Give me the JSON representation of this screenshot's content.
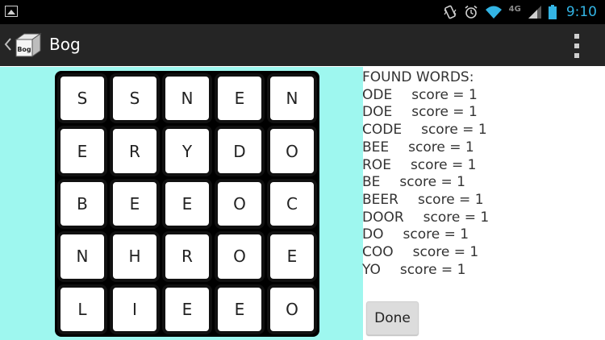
{
  "status_bar": {
    "time": "9:10",
    "network": "4G",
    "icons": [
      "gallery-icon",
      "vibrate-icon",
      "alarm-icon",
      "wifi-icon",
      "signal-icon",
      "battery-icon"
    ]
  },
  "action_bar": {
    "title": "Bog",
    "app_icon_label": "Bog",
    "icons": [
      "up-caret-icon",
      "app-icon",
      "overflow-menu-icon"
    ]
  },
  "board": {
    "rows": [
      [
        "S",
        "S",
        "N",
        "E",
        "N"
      ],
      [
        "E",
        "R",
        "Y",
        "D",
        "O"
      ],
      [
        "B",
        "E",
        "E",
        "O",
        "C"
      ],
      [
        "N",
        "H",
        "R",
        "O",
        "E"
      ],
      [
        "L",
        "I",
        "E",
        "E",
        "O"
      ]
    ]
  },
  "found": {
    "heading": "FOUND WORDS:",
    "items": [
      {
        "word": "ODE",
        "score": "score = 1"
      },
      {
        "word": "DOE",
        "score": "score = 1"
      },
      {
        "word": "CODE",
        "score": "score = 1"
      },
      {
        "word": "BEE",
        "score": "score = 1"
      },
      {
        "word": "ROE",
        "score": "score = 1"
      },
      {
        "word": "BE",
        "score": "score = 1"
      },
      {
        "word": "BEER",
        "score": "score = 1"
      },
      {
        "word": "DOOR",
        "score": "score = 1"
      },
      {
        "word": "DO",
        "score": "score = 1"
      },
      {
        "word": "COO",
        "score": "score = 1"
      },
      {
        "word": "YO",
        "score": "score = 1"
      }
    ]
  },
  "done_label": "Done",
  "colors": {
    "board_background": "#9ef7ef",
    "action_bar": "#252525",
    "status_bar": "#000000",
    "clock": "#33b5e5"
  }
}
